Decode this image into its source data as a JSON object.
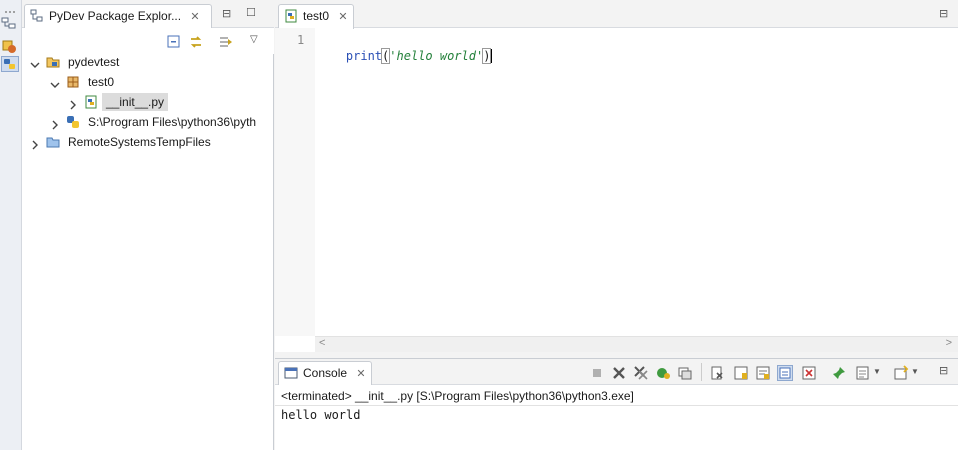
{
  "explorer": {
    "tab_title": "PyDev Package Explor...",
    "close_glyph": "✕",
    "minimize_glyph": "⊟",
    "maximize_glyph": "☐",
    "menu_glyph": "▽",
    "tree": [
      {
        "label": "pydevtest",
        "icon": "project-folder-icon",
        "expanded": true
      },
      {
        "label": "test0",
        "icon": "package-icon",
        "expanded": true
      },
      {
        "label": "__init__.py",
        "icon": "python-file-icon",
        "expanded": false,
        "selected": true
      },
      {
        "label": "S:\\Program Files\\python36\\pyth",
        "icon": "python-interpreter-icon",
        "expanded": false
      },
      {
        "label": "RemoteSystemsTempFiles",
        "icon": "folder-icon",
        "expanded": false
      }
    ]
  },
  "editor": {
    "tab_title": "test0",
    "close_glyph": "✕",
    "minimize_glyph": "⊟",
    "line_number": "1",
    "code_func": "print",
    "code_open": "(",
    "code_string": "'hello world'",
    "code_close": ")",
    "scroll_left_glyph": "<",
    "scroll_right_glyph": ">"
  },
  "console": {
    "tab_title": "Console",
    "close_glyph": "✕",
    "status_line": "<terminated> __init__.py [S:\\Program Files\\python36\\python3.exe]",
    "output": "hello world",
    "minimize_glyph": "⊟"
  },
  "colors": {
    "keyword_blue": "#2a4fb5",
    "string_green": "#23803a",
    "selection_bg": "#dcdcdc",
    "accent": "#3b6fd1"
  }
}
